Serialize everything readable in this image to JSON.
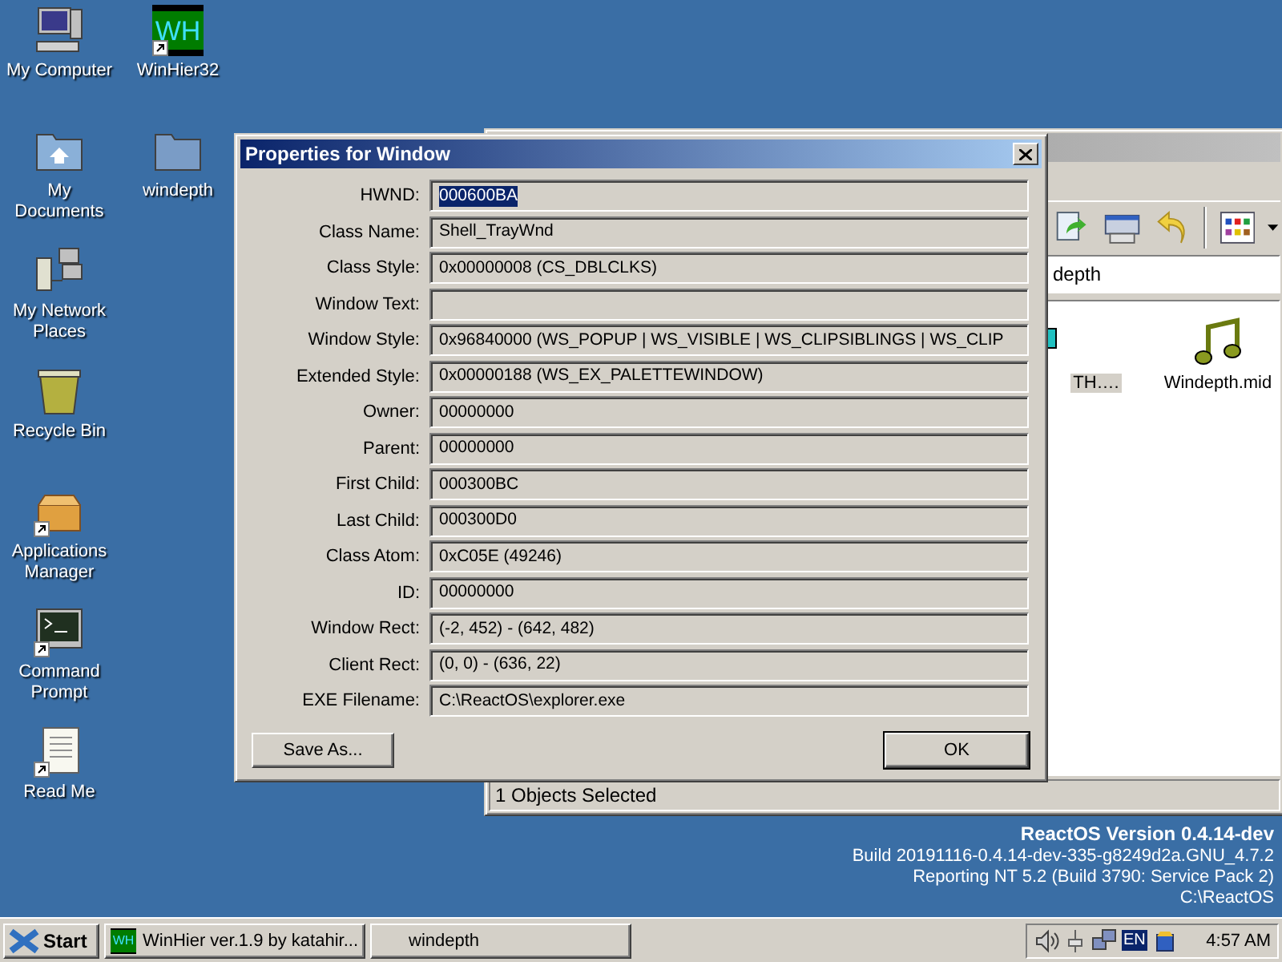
{
  "desktop_icons": [
    {
      "label": "My Computer",
      "kind": "computer",
      "shortcut": false
    },
    {
      "label": "My Documents",
      "kind": "documents",
      "shortcut": false
    },
    {
      "label": "My Network Places",
      "kind": "network",
      "shortcut": false
    },
    {
      "label": "Recycle Bin",
      "kind": "recycle_bin",
      "shortcut": false
    },
    {
      "label": "Applications Manager",
      "kind": "package",
      "shortcut": true
    },
    {
      "label": "Command Prompt",
      "kind": "terminal",
      "shortcut": true
    },
    {
      "label": "Read Me",
      "kind": "document",
      "shortcut": true
    },
    {
      "label": "WinHier32",
      "kind": "app",
      "icon_text": "WH",
      "shortcut": true
    },
    {
      "label": "windepth",
      "kind": "folder",
      "shortcut": false
    }
  ],
  "explorer": {
    "address": "depth",
    "files": [
      {
        "label": "TH….",
        "kind": "app",
        "selected": true
      },
      {
        "label": "Windepth.mid",
        "kind": "music",
        "selected": false
      }
    ],
    "status": "1 Objects Selected"
  },
  "dialog": {
    "title": "Properties for Window",
    "fields": [
      {
        "label": "HWND:",
        "value": "000600BA",
        "selected": true
      },
      {
        "label": "Class Name:",
        "value": "Shell_TrayWnd",
        "selected": false
      },
      {
        "label": "Class Style:",
        "value": "0x00000008 (CS_DBLCLKS)",
        "selected": false
      },
      {
        "label": "Window Text:",
        "selected": false
      },
      {
        "label": "Window Style:",
        "value": "0x96840000 (WS_POPUP | WS_VISIBLE | WS_CLIPSIBLINGS | WS_CLIP",
        "selected": false
      },
      {
        "label": "Extended Style:",
        "value": "0x00000188 (WS_EX_PALETTEWINDOW)",
        "selected": false
      },
      {
        "label": "Owner:",
        "value": "00000000",
        "selected": false
      },
      {
        "label": "Parent:",
        "value": "00000000",
        "selected": false
      },
      {
        "label": "First Child:",
        "value": "000300BC",
        "selected": false
      },
      {
        "label": "Last Child:",
        "value": "000300D0",
        "selected": false
      },
      {
        "label": "Class Atom:",
        "value": "0xC05E (49246)",
        "selected": false
      },
      {
        "label": "ID:",
        "value": "00000000",
        "selected": false
      },
      {
        "label": "Window Rect:",
        "value": "(-2, 452) - (642, 482)",
        "selected": false
      },
      {
        "label": "Client Rect:",
        "value": "(0, 0) - (636, 22)",
        "selected": false
      },
      {
        "label": "EXE Filename:",
        "value": "C:\\ReactOS\\explorer.exe",
        "selected": false
      }
    ],
    "buttons": [
      {
        "label": "Save As...",
        "default": false
      },
      {
        "label": "OK",
        "default": true
      }
    ]
  },
  "version_info": {
    "heading": "ReactOS Version 0.4.14-dev",
    "lines": [
      "Build 20191116-0.4.14-dev-335-g8249d2a.GNU_4.7.2",
      "Reporting NT 5.2 (Build 3790: Service Pack 2)",
      "C:\\ReactOS"
    ]
  },
  "taskbar": {
    "start": "Start",
    "tasks": [
      {
        "label": "WinHier ver.1.9 by katahir...",
        "icon_text": "WH"
      },
      {
        "label": "windepth"
      }
    ],
    "tray": {
      "language": "EN",
      "time": "4:57 AM"
    }
  }
}
